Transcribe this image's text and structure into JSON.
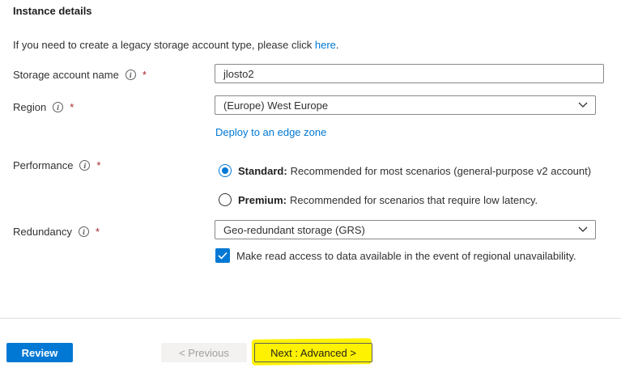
{
  "section": {
    "title": "Instance details"
  },
  "legacy": {
    "text": "If you need to create a legacy storage account type, please click ",
    "link": "here",
    "suffix": "."
  },
  "fields": {
    "storage_account_name": {
      "label": "Storage account name",
      "value": "jlosto2",
      "required": "*"
    },
    "region": {
      "label": "Region",
      "value": "(Europe) West Europe",
      "required": "*"
    },
    "edge_zone_link": "Deploy to an edge zone",
    "performance": {
      "label": "Performance",
      "required": "*",
      "options": [
        {
          "title": "Standard:",
          "desc": "Recommended for most scenarios (general-purpose v2 account)",
          "selected": true
        },
        {
          "title": "Premium:",
          "desc": "Recommended for scenarios that require low latency.",
          "selected": false
        }
      ]
    },
    "redundancy": {
      "label": "Redundancy",
      "value": "Geo-redundant storage (GRS)",
      "required": "*"
    },
    "read_access": {
      "label": "Make read access to data available in the event of regional unavailability.",
      "checked": true
    }
  },
  "footer": {
    "review": "Review",
    "previous": "< Previous",
    "next": "Next : Advanced >"
  },
  "colors": {
    "accent": "#0078d4",
    "required": "#a4262c",
    "highlight": "#fff200"
  }
}
